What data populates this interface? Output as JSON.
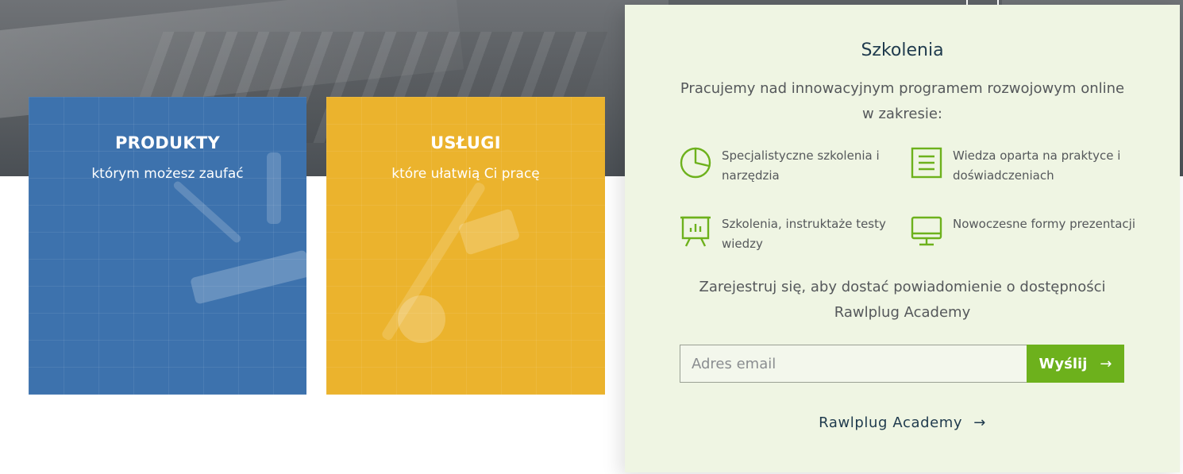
{
  "tiles": {
    "produkty": {
      "title": "PRODUKTY",
      "subtitle": "którym możesz zaufać"
    },
    "uslugi": {
      "title": "USŁUGI",
      "subtitle": "które ułatwią Ci pracę"
    }
  },
  "panel": {
    "title": "Szkolenia",
    "intro": "Pracujemy nad innowacyjnym programem rozwojowym online w zakresie:",
    "features": [
      {
        "icon": "pie-chart-icon",
        "text": "Specjalistyczne szkolenia i narzędzia"
      },
      {
        "icon": "document-lines-icon",
        "text": "Wiedza oparta na praktyce i doświadczeniach"
      },
      {
        "icon": "presentation-board-icon",
        "text": "Szkolenia, instruktaże testy wiedzy"
      },
      {
        "icon": "monitor-icon",
        "text": "Nowoczesne formy prezentacji"
      }
    ],
    "register_text": "Zarejestruj się, aby dostać powiadomienie o dostępności Rawlplug Academy",
    "email_placeholder": "Adres email",
    "email_value": "",
    "send_label": "Wyślij",
    "send_arrow": "→",
    "academy_link": "Rawlplug Academy",
    "academy_arrow": "→"
  },
  "colors": {
    "produkty_tile": "#3d72ad",
    "uslugi_tile": "#ebb32d",
    "panel_background": "#eff5e3",
    "accent_green": "#6db11c",
    "title_navy": "#1f3a4d"
  }
}
